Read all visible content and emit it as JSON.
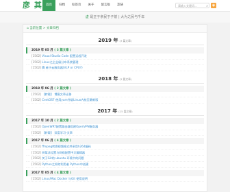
{
  "header": {
    "logo": "彦 其 灵",
    "nav": [
      "首页",
      "归档",
      "标签页",
      "关于",
      "留言板",
      "友链"
    ],
    "search_placeholder": "请输入关键词..."
  },
  "banner": {
    "text_a": "虚",
    "text_b": "是正子亲民于子前",
    "sep": "|",
    "text_c": "大为之民与千年"
  },
  "breadcrumb": "当前位置 > 文章归档",
  "archive": [
    {
      "year": "2019 年",
      "count": "(3 篇文章)",
      "months": [
        {
          "label": "2019 年 05 月",
          "count": "( 3 篇文章 )",
          "items": [
            {
              "date": "[1502]",
              "title": "Visual Studio Code 配置远程开发"
            },
            {
              "date": "[1502]",
              "title": "Linux之企业级分布系统管理"
            },
            {
              "date": "[1502]",
              "title": "腾 者于云服务器(VLP or CPU?)"
            }
          ]
        }
      ]
    },
    {
      "year": "2018 年",
      "count": "(3 篇文章)",
      "months": [
        {
          "label": "2018 年 06 月",
          "count": "( 2 篇文章 )",
          "items": [
            {
              "date": "[1502]",
              "title": "【转载】 博客文章迁移"
            },
            {
              "date": "[1502]",
              "title": "CentOS7 使用yum升级Linux内核至最新版"
            }
          ]
        }
      ]
    },
    {
      "year": "2017 年",
      "count": "(15 篇文章)",
      "months": [
        {
          "label": "2017 年 10 月",
          "count": "( 2 篇文章 )",
          "items": [
            {
              "date": "[1502]",
              "title": "OpenWRT配置路由器搭建OpenVPN服务器"
            },
            {
              "date": "[1502]",
              "title": "【转载】 深度学习-文章"
            }
          ]
        },
        {
          "label": "2017 年 06 月",
          "count": "( 4 篇文章 )",
          "items": [
            {
              "date": "[1502]",
              "title": "ffmpeg转换视频格式并采用h264编码"
            },
            {
              "date": "[1502]",
              "title": "树莓派设置与网络配置中文编辑器"
            },
            {
              "date": "[1502]",
              "title": "关于Git的 ubuntu 环境中的问题"
            },
            {
              "date": "[1502]",
              "title": "Python之如何利用者 Python中创建"
            }
          ]
        },
        {
          "label": "2017 年 05 月",
          "count": "( 4 篇文章 )",
          "items": [
            {
              "date": "[1502]",
              "title": "Linux/Mac Docker 与Git 使用说明"
            }
          ]
        }
      ]
    }
  ],
  "colors": {
    "accent": "#3aa05c",
    "link": "#3a8fd0"
  }
}
